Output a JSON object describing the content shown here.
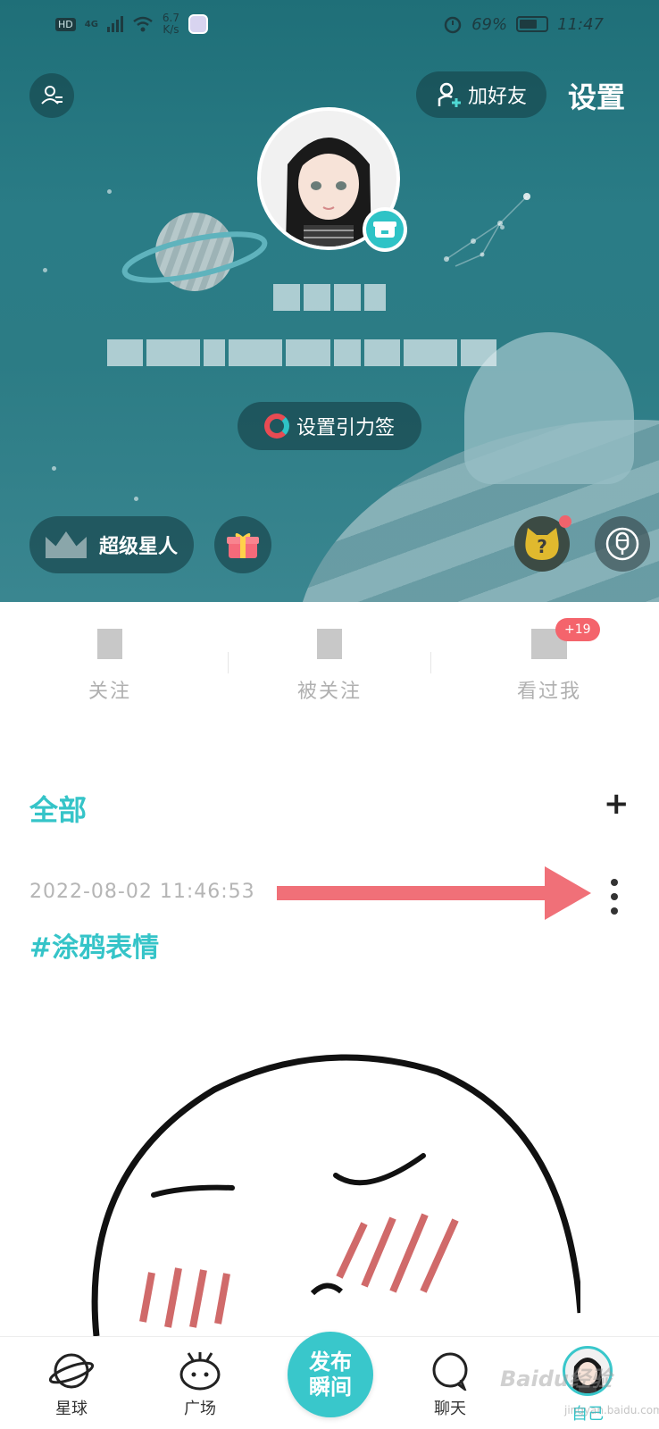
{
  "status_bar": {
    "hd": "HD",
    "network": "4G",
    "speed_value": "6.7",
    "speed_unit": "K/s",
    "battery": "69%",
    "time": "11:47"
  },
  "header": {
    "add_friend_label": "加好友",
    "settings_label": "设置",
    "gravity_tag_label": "设置引力签",
    "super_star_label": "超级星人"
  },
  "stats": {
    "items": [
      {
        "label": "关注"
      },
      {
        "label": "被关注"
      },
      {
        "label": "看过我"
      }
    ],
    "visitors_badge": "+19"
  },
  "feed": {
    "section_title": "全部",
    "add_label": "+",
    "post": {
      "timestamp": "2022-08-02 11:46:53",
      "tag": "#涂鸦表情"
    }
  },
  "bottom_nav": {
    "items": [
      {
        "label": "星球",
        "icon": "planet-icon"
      },
      {
        "label": "广场",
        "icon": "square-icon"
      },
      {
        "label": "聊天",
        "icon": "chat-icon"
      },
      {
        "label": "自己",
        "icon": "avatar"
      }
    ],
    "publish_line1": "发布",
    "publish_line2": "瞬间"
  },
  "watermark": {
    "text": "Baidu经验",
    "sub": "jingyan.baidu.com"
  },
  "colors": {
    "accent": "#35c4c8",
    "hero": "#2a7c86",
    "badge_red": "#f4646c",
    "arrow": "#f07078"
  }
}
